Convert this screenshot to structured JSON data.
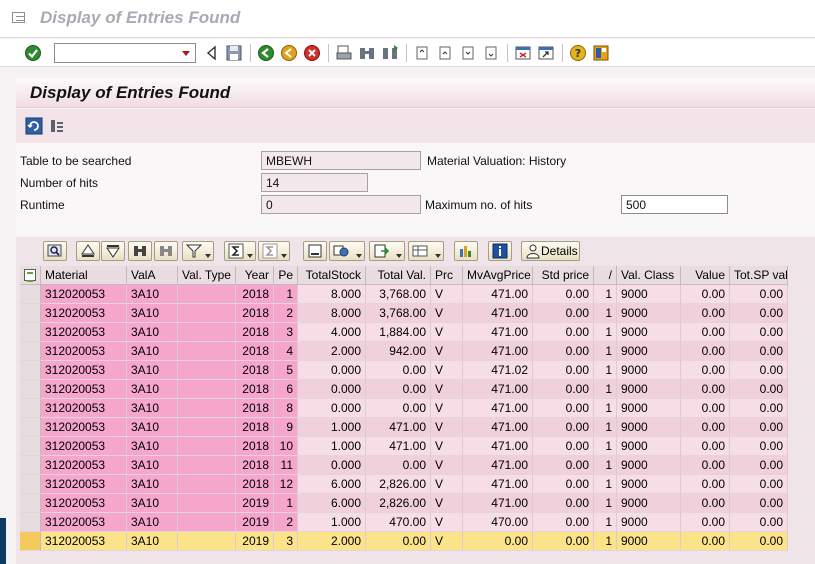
{
  "window": {
    "title": "Display of Entries Found"
  },
  "std_toolbar": {
    "command_value": "",
    "command_placeholder": ""
  },
  "screen": {
    "title": "Display of Entries Found"
  },
  "form": {
    "table_label": "Table to be searched",
    "table_value": "MBEWH",
    "table_desc": "Material Valuation: History",
    "hits_label": "Number of hits",
    "hits_value": "14",
    "runtime_label": "Runtime",
    "runtime_value": "0",
    "maxhits_label": "Maximum no. of hits",
    "maxhits_value": "500"
  },
  "alv_toolbar": {
    "details_label": "Details"
  },
  "table": {
    "columns": [
      "Material",
      "ValA",
      "Val. Type",
      "Year",
      "Pe",
      "TotalStock",
      "Total Val.",
      "Prc",
      "MvAvgPrice",
      "Std price",
      "/",
      "Val. Class",
      "Value",
      "Tot.SP val"
    ],
    "rows": [
      [
        "312020053",
        "3A10",
        "",
        "2018",
        "1",
        "8.000",
        "3,768.00",
        "V",
        "471.00",
        "0.00",
        "1",
        "9000",
        "0.00",
        "0.00"
      ],
      [
        "312020053",
        "3A10",
        "",
        "2018",
        "2",
        "8.000",
        "3,768.00",
        "V",
        "471.00",
        "0.00",
        "1",
        "9000",
        "0.00",
        "0.00"
      ],
      [
        "312020053",
        "3A10",
        "",
        "2018",
        "3",
        "4.000",
        "1,884.00",
        "V",
        "471.00",
        "0.00",
        "1",
        "9000",
        "0.00",
        "0.00"
      ],
      [
        "312020053",
        "3A10",
        "",
        "2018",
        "4",
        "2.000",
        "942.00",
        "V",
        "471.00",
        "0.00",
        "1",
        "9000",
        "0.00",
        "0.00"
      ],
      [
        "312020053",
        "3A10",
        "",
        "2018",
        "5",
        "0.000",
        "0.00",
        "V",
        "471.02",
        "0.00",
        "1",
        "9000",
        "0.00",
        "0.00"
      ],
      [
        "312020053",
        "3A10",
        "",
        "2018",
        "6",
        "0.000",
        "0.00",
        "V",
        "471.00",
        "0.00",
        "1",
        "9000",
        "0.00",
        "0.00"
      ],
      [
        "312020053",
        "3A10",
        "",
        "2018",
        "8",
        "0.000",
        "0.00",
        "V",
        "471.00",
        "0.00",
        "1",
        "9000",
        "0.00",
        "0.00"
      ],
      [
        "312020053",
        "3A10",
        "",
        "2018",
        "9",
        "1.000",
        "471.00",
        "V",
        "471.00",
        "0.00",
        "1",
        "9000",
        "0.00",
        "0.00"
      ],
      [
        "312020053",
        "3A10",
        "",
        "2018",
        "10",
        "1.000",
        "471.00",
        "V",
        "471.00",
        "0.00",
        "1",
        "9000",
        "0.00",
        "0.00"
      ],
      [
        "312020053",
        "3A10",
        "",
        "2018",
        "11",
        "0.000",
        "0.00",
        "V",
        "471.00",
        "0.00",
        "1",
        "9000",
        "0.00",
        "0.00"
      ],
      [
        "312020053",
        "3A10",
        "",
        "2018",
        "12",
        "6.000",
        "2,826.00",
        "V",
        "471.00",
        "0.00",
        "1",
        "9000",
        "0.00",
        "0.00"
      ],
      [
        "312020053",
        "3A10",
        "",
        "2019",
        "1",
        "6.000",
        "2,826.00",
        "V",
        "471.00",
        "0.00",
        "1",
        "9000",
        "0.00",
        "0.00"
      ],
      [
        "312020053",
        "3A10",
        "",
        "2019",
        "2",
        "1.000",
        "470.00",
        "V",
        "470.00",
        "0.00",
        "1",
        "9000",
        "0.00",
        "0.00"
      ],
      [
        "312020053",
        "3A10",
        "",
        "2019",
        "3",
        "2.000",
        "0.00",
        "V",
        "0.00",
        "0.00",
        "1",
        "9000",
        "0.00",
        "0.00"
      ]
    ],
    "selected_row": 13
  }
}
